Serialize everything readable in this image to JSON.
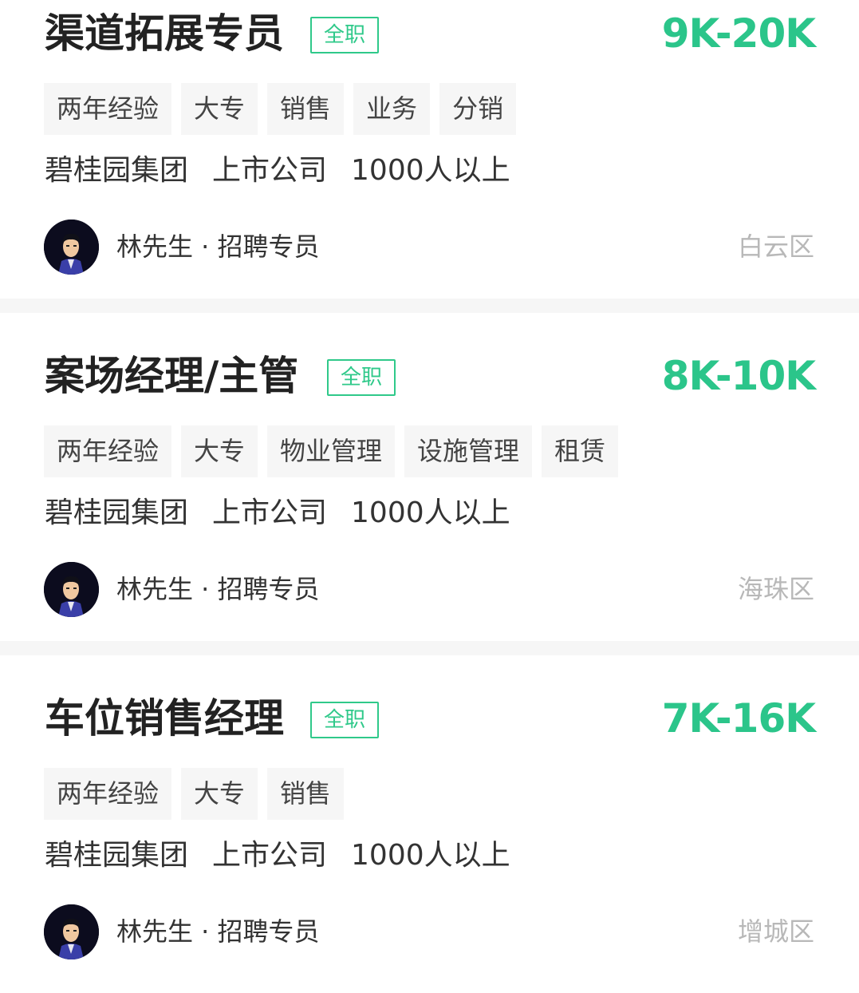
{
  "jobs": [
    {
      "title": "渠道拓展专员",
      "type_badge": "全职",
      "salary": "9K-20K",
      "tags": [
        "两年经验",
        "大专",
        "销售",
        "业务",
        "分销"
      ],
      "company": "碧桂园集团",
      "company_stage": "上市公司",
      "company_size": "1000人以上",
      "recruiter": "林先生 · 招聘专员",
      "district": "白云区"
    },
    {
      "title": "案场经理/主管",
      "type_badge": "全职",
      "salary": "8K-10K",
      "tags": [
        "两年经验",
        "大专",
        "物业管理",
        "设施管理",
        "租赁"
      ],
      "company": "碧桂园集团",
      "company_stage": "上市公司",
      "company_size": "1000人以上",
      "recruiter": "林先生 · 招聘专员",
      "district": "海珠区"
    },
    {
      "title": "车位销售经理",
      "type_badge": "全职",
      "salary": "7K-16K",
      "tags": [
        "两年经验",
        "大专",
        "销售"
      ],
      "company": "碧桂园集团",
      "company_stage": "上市公司",
      "company_size": "1000人以上",
      "recruiter": "林先生 · 招聘专员",
      "district": "增城区"
    }
  ],
  "colors": {
    "salary": "#2bc58a",
    "badge": "#2fc98a",
    "tag_bg": "#f6f6f6",
    "separator": "#f6f6f6",
    "district": "#b8b8b8"
  },
  "icons": {
    "recruiter_avatar": "avatar"
  }
}
